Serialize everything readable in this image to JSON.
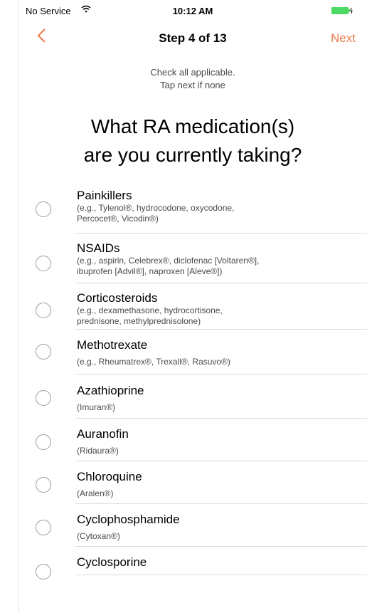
{
  "status_bar": {
    "carrier": "No Service",
    "time": "10:12 AM"
  },
  "nav": {
    "title": "Step 4 of 13",
    "next_label": "Next",
    "accent_color": "#f0794b"
  },
  "instructions": {
    "line1": "Check all applicable.",
    "line2": "Tap next if none"
  },
  "question": {
    "line1": "What RA medication(s)",
    "line2": "are you currently taking?"
  },
  "options": [
    {
      "title": "Painkillers",
      "subtitle_line1": "(e.g., Tylenol®, hydrocodone, oxycodone,",
      "subtitle_line2": "Percocet®, Vicodin®)"
    },
    {
      "title": "NSAIDs",
      "subtitle_line1": "(e.g., aspirin, Celebrex®, diclofenac [Voltaren®],",
      "subtitle_line2": "ibuprofen [Advil®], naproxen [Aleve®])"
    },
    {
      "title": "Corticosteroids",
      "subtitle_line1": "(e.g., dexamethasone, hydrocortisone,",
      "subtitle_line2": "prednisone, methylprednisolone)"
    },
    {
      "title": "Methotrexate",
      "subtitle_line1": "(e.g., Rheumatrex®, Trexall®, Rasuvo®)"
    },
    {
      "title": "Azathioprine",
      "subtitle_line1": "(Imuran®)"
    },
    {
      "title": "Auranofin",
      "subtitle_line1": "(Ridaura®)"
    },
    {
      "title": "Chloroquine",
      "subtitle_line1": "(Aralen®)"
    },
    {
      "title": "Cyclophosphamide",
      "subtitle_line1": "(Cytoxan®)"
    },
    {
      "title": "Cyclosporine"
    }
  ]
}
